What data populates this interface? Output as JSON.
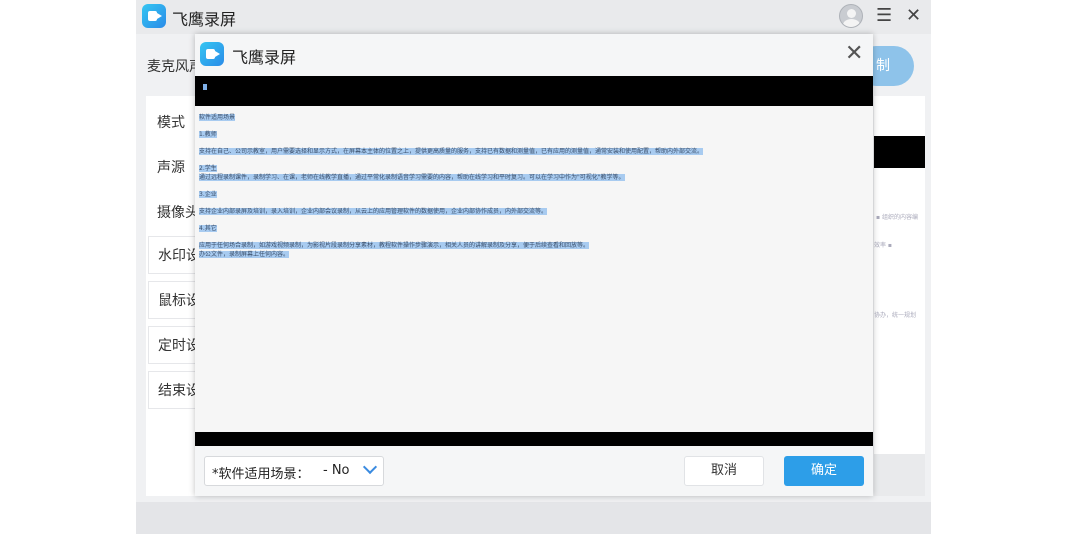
{
  "app": {
    "title": "飞鹰录屏",
    "mic_label": "麦克风声",
    "record_button": "制",
    "sidebar": [
      "模式",
      "声源",
      "摄像头",
      "水印设",
      "鼠标设",
      "定时设",
      "结束设"
    ]
  },
  "dialog": {
    "title": "飞鹰录屏",
    "document_lines": [
      "软件适用场景",
      "1.教师",
      "支持在自己、公司示教室，用户需要选择和显示方式，在屏幕本主体的位置之上，提供更高质量的服务，支持已有数据和测量值，已有应用的测量值，通常安装和使用配置，帮助内外部交流。",
      "2.学生",
      "通过远程录制课件，录制学习、在课，老师在线教学直播，通过平常化录制语音学习需要的内容，帮助在线学习和平时复习。可以在学习中作为\"可视化\"教学等。",
      "3.企业",
      "支持企业内部录屏及培训，录入培训，企业内部会议录制，从云上的应用管理软件的数据使用，企业内部协作成员，内外部交流等。",
      "4.其它",
      "应用于任何场合录制，如游戏视频录制，为影视片段录制分享素材，教程软件操作步骤演示，相关人员的讲解录制及分享，便于后续查看和回放等。",
      "办公文件，录制屏幕上任何内容。"
    ],
    "scene_label": "*软件适用场景：",
    "scene_value": "- No",
    "cancel_label": "取消",
    "confirm_label": "确定"
  }
}
